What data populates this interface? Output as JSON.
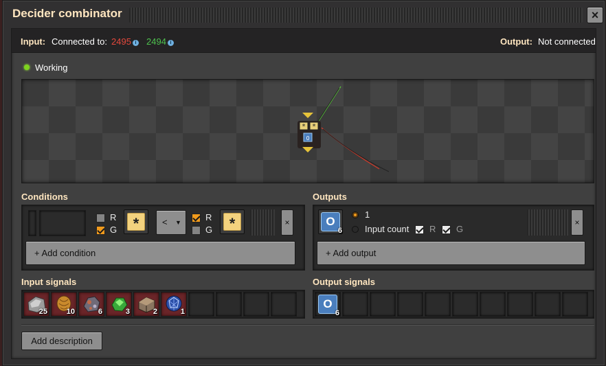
{
  "window": {
    "title": "Decider combinator"
  },
  "header": {
    "input_label": "Input:",
    "connected_label": "Connected to:",
    "red_network_id": "2495",
    "green_network_id": "2494",
    "output_label": "Output:",
    "output_value": "Not connected"
  },
  "status": {
    "label": "Working",
    "color": "#7dd31e"
  },
  "conditions": {
    "title": "Conditions",
    "left_networks": {
      "r_label": "R",
      "g_label": "G",
      "r_checked": false,
      "g_checked": true
    },
    "left_signal": "*",
    "comparator": "<",
    "right_networks": {
      "r_label": "R",
      "g_label": "G",
      "r_checked": true,
      "g_checked": false
    },
    "right_signal": "*",
    "remove_label": "×",
    "add_label": "+ Add condition"
  },
  "outputs": {
    "title": "Outputs",
    "signal": {
      "letter": "O",
      "count": "6"
    },
    "value_option": "1",
    "count_option": "Input count",
    "r_label": "R",
    "g_label": "G",
    "remove_label": "×",
    "add_label": "+ Add output"
  },
  "input_signals": {
    "title": "Input signals",
    "items": [
      {
        "icon": "stone-icon",
        "count": "25"
      },
      {
        "icon": "wood-icon",
        "count": "10"
      },
      {
        "icon": "iron-ore-icon",
        "count": "6"
      },
      {
        "icon": "uranium-ore-icon",
        "count": "3"
      },
      {
        "icon": "stone-brick-icon",
        "count": "2"
      },
      {
        "icon": "coal-crystal-icon",
        "count": "1"
      }
    ]
  },
  "output_signals": {
    "title": "Output signals",
    "items": [
      {
        "letter": "O",
        "count": "6"
      }
    ]
  },
  "description": {
    "button_label": "Add description"
  },
  "close_label": "×"
}
